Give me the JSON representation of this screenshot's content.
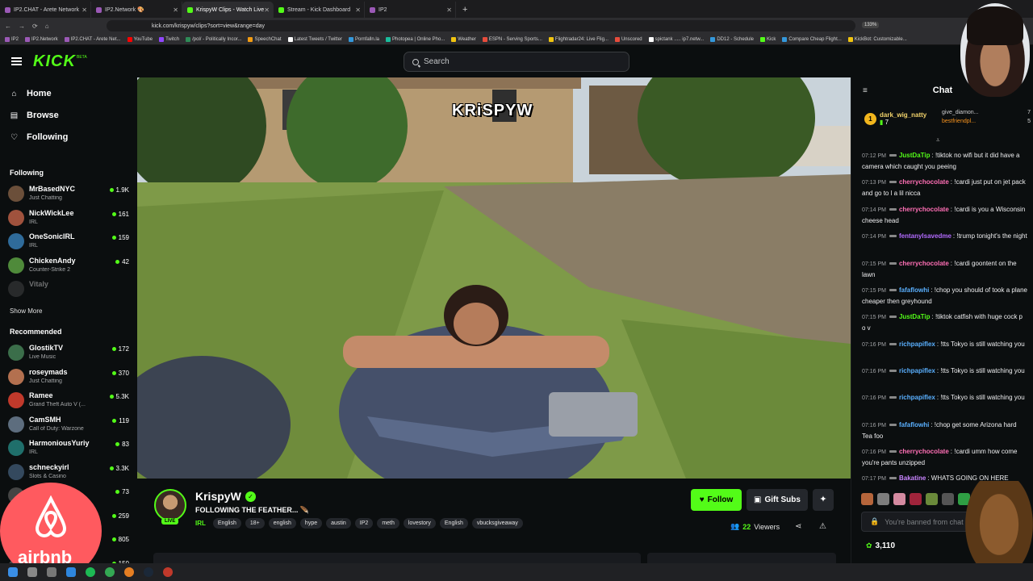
{
  "browser": {
    "tabs": [
      {
        "label": "IP2.CHAT - Arete Network",
        "color": "#9b59b6",
        "active": false
      },
      {
        "label": "IP2.Network 🎨",
        "color": "#9b59b6",
        "active": false
      },
      {
        "label": "KrispyW Clips - Watch Live",
        "color": "#53fc18",
        "active": true
      },
      {
        "label": "Stream - Kick Dashboard",
        "color": "#53fc18",
        "active": false
      },
      {
        "label": "IP2",
        "color": "#9b59b6",
        "active": false
      }
    ],
    "new_tab": "+",
    "url": "kick.com/krispyw/clips?sort=view&range=day",
    "zoom": "133%",
    "bookmarks": [
      {
        "label": "IP2",
        "color": "#9b59b6"
      },
      {
        "label": "IP2.Network",
        "color": "#9b59b6"
      },
      {
        "label": "IP2.CHAT - Arete Net...",
        "color": "#9b59b6"
      },
      {
        "label": "YouTube",
        "color": "#ff0000"
      },
      {
        "label": "Twitch",
        "color": "#9146ff"
      },
      {
        "label": "/pol/ - Politically Incor...",
        "color": "#2e8b57"
      },
      {
        "label": "SpeechChat",
        "color": "#f39c12"
      },
      {
        "label": "Latest Tweets / Twitter",
        "color": "#ffffff"
      },
      {
        "label": "Pornfalln.la",
        "color": "#3498db"
      },
      {
        "label": "Photopea | Online Pho...",
        "color": "#1abc9c"
      },
      {
        "label": "Weather",
        "color": "#f1c40f"
      },
      {
        "label": "ESPN - Serving Sports...",
        "color": "#e74c3c"
      },
      {
        "label": "Flightradar24: Live Flig...",
        "color": "#f1c40f"
      },
      {
        "label": "Unscored",
        "color": "#e74c3c"
      },
      {
        "label": "spictank ..... ip7.netw...",
        "color": "#ffffff"
      },
      {
        "label": "DD12 - Schedule",
        "color": "#3498db"
      },
      {
        "label": "Kick",
        "color": "#53fc18"
      },
      {
        "label": "Compare Cheap Flight...",
        "color": "#3498db"
      },
      {
        "label": "KickBot: Customizable...",
        "color": "#f1c40f"
      }
    ]
  },
  "header": {
    "logo": "KICK",
    "logo_badge": "BETA",
    "search_placeholder": "Search"
  },
  "sidebar": {
    "nav": [
      {
        "label": "Home",
        "icon": "home-icon",
        "glyph": "⌂"
      },
      {
        "label": "Browse",
        "icon": "browse-icon",
        "glyph": "▤"
      },
      {
        "label": "Following",
        "icon": "heart-icon",
        "glyph": "♡"
      }
    ],
    "following_title": "Following",
    "following": [
      {
        "name": "MrBasedNYC",
        "category": "Just Chatting",
        "viewers": "1.9K",
        "color": "#6b4f3a"
      },
      {
        "name": "NickWickLee",
        "category": "IRL",
        "viewers": "161",
        "color": "#a0523d"
      },
      {
        "name": "OneSonicIRL",
        "category": "IRL",
        "viewers": "159",
        "color": "#2f6b9a"
      },
      {
        "name": "ChickenAndy",
        "category": "Counter-Strike 2",
        "viewers": "42",
        "color": "#4f8a3a"
      },
      {
        "name": "Vitaly",
        "category": "",
        "viewers": "",
        "color": "#555555"
      }
    ],
    "show_more": "Show More",
    "recommended_title": "Recommended",
    "recommended": [
      {
        "name": "GlostikTV",
        "category": "Live Music",
        "viewers": "172",
        "color": "#3b6e4a"
      },
      {
        "name": "roseymads",
        "category": "Just Chatting",
        "viewers": "370",
        "color": "#b3704f"
      },
      {
        "name": "Ramee",
        "category": "Grand Theft Auto V (...",
        "viewers": "5.3K",
        "color": "#c0392b"
      },
      {
        "name": "CamSMH",
        "category": "Call of Duty: Warzone",
        "viewers": "119",
        "color": "#5d6d7e"
      },
      {
        "name": "HarmoniousYuriy",
        "category": "IRL",
        "viewers": "83",
        "color": "#1f6f6b"
      },
      {
        "name": "schneckyirl",
        "category": "Slots & Casino",
        "viewers": "3.3K",
        "color": "#34495e"
      },
      {
        "name": "",
        "category": "",
        "viewers": "73",
        "color": "#444444"
      },
      {
        "name": "",
        "category": "",
        "viewers": "259",
        "color": "#444444"
      },
      {
        "name": "",
        "category": "",
        "viewers": "805",
        "color": "#444444"
      },
      {
        "name": "",
        "category": "",
        "viewers": "150",
        "color": "#444444"
      }
    ]
  },
  "video": {
    "watermark": "KRiSPYW"
  },
  "stream": {
    "streamer": "KrispyW",
    "live_label": "LIVE",
    "title": "FOLLOWING THE FEATHER... 🪶",
    "category": "IRL",
    "tags": [
      "English",
      "18+",
      "english",
      "hype",
      "austin",
      "IP2",
      "meth",
      "lovestory",
      "English",
      "vbucksgiveaway"
    ],
    "follow_label": "Follow",
    "gift_label": "Gift Subs",
    "viewer_count": "22",
    "viewers_label": "Viewers",
    "accent": "#53fc18"
  },
  "chat": {
    "title": "Chat",
    "leaderboard": {
      "top": {
        "rank": "1",
        "name": "dark_wig_natty",
        "count": "7"
      },
      "others": [
        {
          "name": "give_diamon...",
          "count": "7",
          "highlight": false
        },
        {
          "name": "bestfriendpl...",
          "count": "5",
          "highlight": true
        }
      ]
    },
    "messages": [
      {
        "time": "07:12 PM",
        "user": "JustDaTip",
        "color": "#53fc18",
        "text": "!tiktok no wifi but it did have a camera which caught you peeing"
      },
      {
        "time": "07:13 PM",
        "user": "cherrychocolate",
        "color": "#ff6fb5",
        "text": "!cardi just put on jet pack and go to l a lil nicca"
      },
      {
        "time": "07:14 PM",
        "user": "cherrychocolate",
        "color": "#ff6fb5",
        "text": "!cardi is you a Wisconsin cheese head"
      },
      {
        "time": "07:14 PM",
        "user": "fentanylsavedme",
        "color": "#b36bff",
        "text": "!trump tonight's the night"
      },
      {
        "time": "07:15 PM",
        "user": "cherrychocolate",
        "color": "#ff6fb5",
        "text": "!cardi goontent on the lawn"
      },
      {
        "time": "07:15 PM",
        "user": "fafaflowhi",
        "color": "#5ab0ff",
        "text": "!chop you should of took a plane cheaper then greyhound"
      },
      {
        "time": "07:15 PM",
        "user": "JustDaTip",
        "color": "#53fc18",
        "text": "!tiktok catfish with huge cock p o v"
      },
      {
        "time": "07:16 PM",
        "user": "richpapiflex",
        "color": "#5ab0ff",
        "text": "!tts Tokyo is still watching you"
      },
      {
        "time": "07:16 PM",
        "user": "richpapiflex",
        "color": "#5ab0ff",
        "text": "!tts Tokyo is still watching you"
      },
      {
        "time": "07:16 PM",
        "user": "richpapiflex",
        "color": "#5ab0ff",
        "text": "!tts Tokyo is still watching you"
      },
      {
        "time": "07:16 PM",
        "user": "fafaflowhi",
        "color": "#5ab0ff",
        "text": "!chop get some Arizona hard Tea foo"
      },
      {
        "time": "07:16 PM",
        "user": "cherrychocolate",
        "color": "#ff6fb5",
        "text": "!cardi umm how come you're pants unzipped"
      },
      {
        "time": "07:17 PM",
        "user": "Bakatine",
        "color": "#c985ff",
        "text": "WHATS GOING ON HERE"
      }
    ],
    "input_placeholder": "You're banned from chat",
    "points": "3,110"
  },
  "overlays": {
    "airbnb_text": "airbnb"
  }
}
